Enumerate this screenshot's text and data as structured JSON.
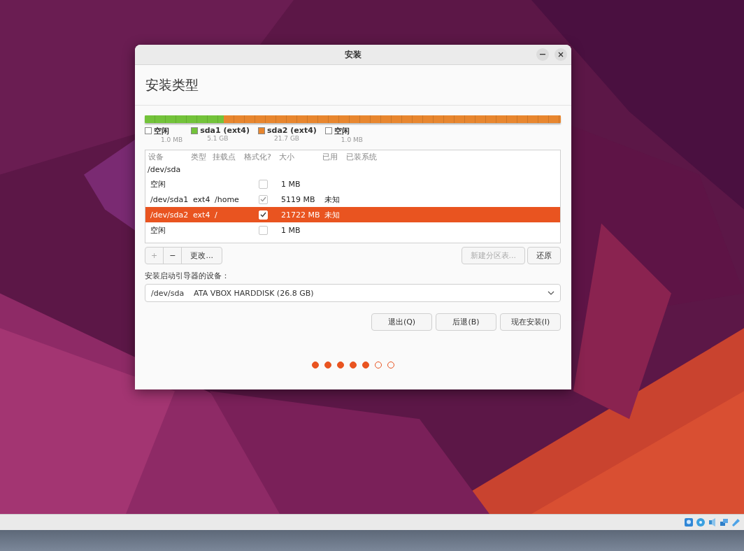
{
  "window": {
    "title": "安装"
  },
  "heading": "安装类型",
  "partition_bar": [
    {
      "color": "#73c33a",
      "level": 0.19
    },
    {
      "color": "#e8862e",
      "level": 0.81
    }
  ],
  "legend": [
    {
      "name": "空闲",
      "size": "1.0 MB",
      "color": "#ffffff"
    },
    {
      "name": "sda1 (ext4)",
      "size": "5.1 GB",
      "color": "#73c33a"
    },
    {
      "name": "sda2 (ext4)",
      "size": "21.7 GB",
      "color": "#e8862e"
    },
    {
      "name": "空闲",
      "size": "1.0 MB",
      "color": "#ffffff"
    }
  ],
  "table": {
    "columns": [
      "设备",
      "类型",
      "挂载点",
      "格式化?",
      "大小",
      "已用",
      "已装系统"
    ],
    "disk": "/dev/sda",
    "rows": [
      {
        "device": "空闲",
        "type": "",
        "mount": "",
        "format": false,
        "size": "1 MB",
        "used": "",
        "selected": false
      },
      {
        "device": "/dev/sda1",
        "type": "ext4",
        "mount": "/home",
        "format": true,
        "size": "5119 MB",
        "used": "未知",
        "selected": false
      },
      {
        "device": "/dev/sda2",
        "type": "ext4",
        "mount": "/",
        "format": true,
        "size": "21722 MB",
        "used": "未知",
        "selected": true
      },
      {
        "device": "空闲",
        "type": "",
        "mount": "",
        "format": false,
        "size": "1 MB",
        "used": "",
        "selected": false
      }
    ]
  },
  "edit_buttons": [
    {
      "label": "+",
      "disabled": true
    },
    {
      "label": "−",
      "disabled": false
    },
    {
      "label": "更改...",
      "disabled": false
    }
  ],
  "table_buttons": [
    {
      "label": "新建分区表...",
      "disabled": true
    },
    {
      "label": "还原",
      "disabled": false
    }
  ],
  "bootloader": {
    "label": "安装启动引导器的设备：",
    "value": "/dev/sda    ATA VBOX HARDDISK (26.8 GB)"
  },
  "nav_buttons": [
    "退出(Q)",
    "后退(B)",
    "现在安装(I)"
  ],
  "steps": [
    {
      "done": true
    },
    {
      "done": true
    },
    {
      "done": true
    },
    {
      "done": true
    },
    {
      "done": true
    },
    {
      "done": false
    },
    {
      "done": false
    }
  ]
}
